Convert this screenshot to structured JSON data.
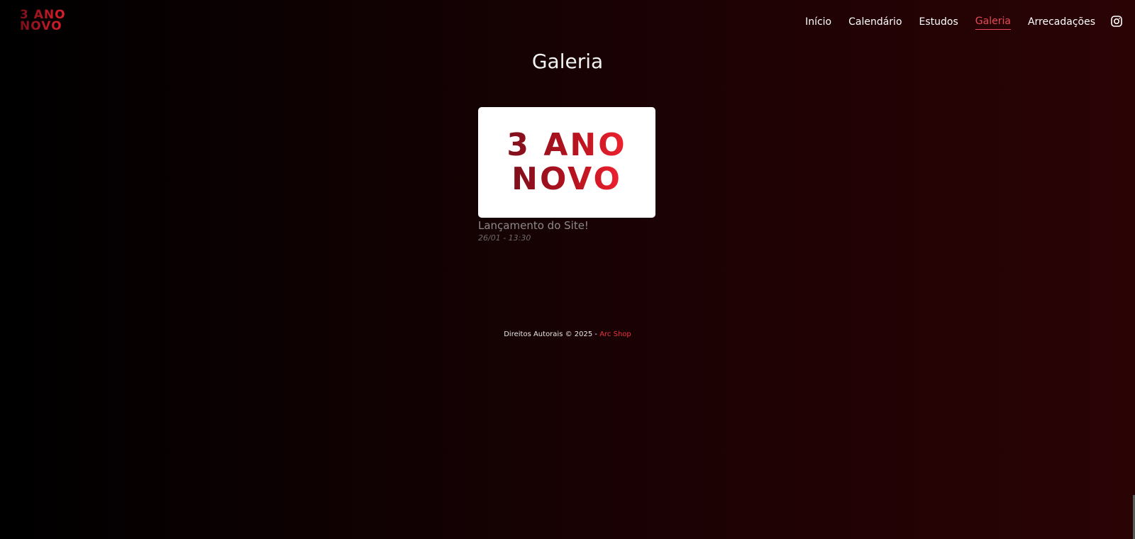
{
  "header": {
    "logo_line1": "3 ANO",
    "logo_line2": "NOVO",
    "nav": [
      {
        "label": "Início"
      },
      {
        "label": "Calendário"
      },
      {
        "label": "Estudos"
      },
      {
        "label": "Galeria",
        "active": true
      },
      {
        "label": "Arrecadações"
      }
    ],
    "social_icon": "instagram-icon"
  },
  "page": {
    "title": "Galeria"
  },
  "gallery": {
    "items": [
      {
        "image_line1": "3 ANO",
        "image_line2": "NOVO",
        "title": "Lançamento do Site!",
        "date": "26/01 - 13:30"
      }
    ]
  },
  "footer": {
    "text": "Direitos Autorais © 2025 - ",
    "link_label": "Arc Shop"
  },
  "colors": {
    "accent": "#e84a55",
    "brand_dark": "#7e0f1c",
    "brand_light": "#f0222f"
  }
}
